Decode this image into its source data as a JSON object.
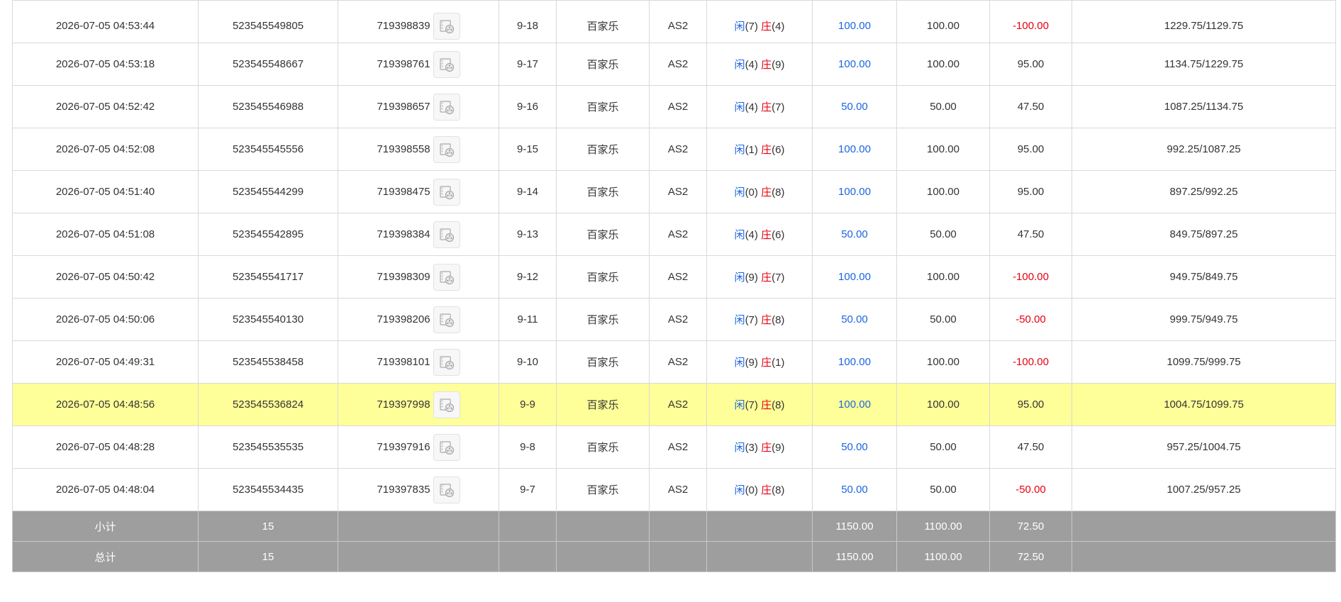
{
  "colors": {
    "blue": "#1a66e0",
    "red": "#e60012",
    "highlight": "#ffff99",
    "summary_bg": "#9e9e9e"
  },
  "rows": [
    {
      "time": "2026-07-05 04:53:44",
      "bet_no": "523545549805",
      "game_no": "719398839",
      "round": "9-18",
      "game": "百家乐",
      "table": "AS2",
      "player_label": "闲",
      "player_val": "(7)",
      "banker_label": "庄",
      "banker_val": "(4)",
      "bet": "100.00",
      "valid": "100.00",
      "win": "-100.00",
      "balance": "1229.75/1129.75"
    },
    {
      "time": "2026-07-05 04:53:18",
      "bet_no": "523545548667",
      "game_no": "719398761",
      "round": "9-17",
      "game": "百家乐",
      "table": "AS2",
      "player_label": "闲",
      "player_val": "(4)",
      "banker_label": "庄",
      "banker_val": "(9)",
      "bet": "100.00",
      "valid": "100.00",
      "win": "95.00",
      "balance": "1134.75/1229.75"
    },
    {
      "time": "2026-07-05 04:52:42",
      "bet_no": "523545546988",
      "game_no": "719398657",
      "round": "9-16",
      "game": "百家乐",
      "table": "AS2",
      "player_label": "闲",
      "player_val": "(4)",
      "banker_label": "庄",
      "banker_val": "(7)",
      "bet": "50.00",
      "valid": "50.00",
      "win": "47.50",
      "balance": "1087.25/1134.75"
    },
    {
      "time": "2026-07-05 04:52:08",
      "bet_no": "523545545556",
      "game_no": "719398558",
      "round": "9-15",
      "game": "百家乐",
      "table": "AS2",
      "player_label": "闲",
      "player_val": "(1)",
      "banker_label": "庄",
      "banker_val": "(6)",
      "bet": "100.00",
      "valid": "100.00",
      "win": "95.00",
      "balance": "992.25/1087.25"
    },
    {
      "time": "2026-07-05 04:51:40",
      "bet_no": "523545544299",
      "game_no": "719398475",
      "round": "9-14",
      "game": "百家乐",
      "table": "AS2",
      "player_label": "闲",
      "player_val": "(0)",
      "banker_label": "庄",
      "banker_val": "(8)",
      "bet": "100.00",
      "valid": "100.00",
      "win": "95.00",
      "balance": "897.25/992.25"
    },
    {
      "time": "2026-07-05 04:51:08",
      "bet_no": "523545542895",
      "game_no": "719398384",
      "round": "9-13",
      "game": "百家乐",
      "table": "AS2",
      "player_label": "闲",
      "player_val": "(4)",
      "banker_label": "庄",
      "banker_val": "(6)",
      "bet": "50.00",
      "valid": "50.00",
      "win": "47.50",
      "balance": "849.75/897.25"
    },
    {
      "time": "2026-07-05 04:50:42",
      "bet_no": "523545541717",
      "game_no": "719398309",
      "round": "9-12",
      "game": "百家乐",
      "table": "AS2",
      "player_label": "闲",
      "player_val": "(9)",
      "banker_label": "庄",
      "banker_val": "(7)",
      "bet": "100.00",
      "valid": "100.00",
      "win": "-100.00",
      "balance": "949.75/849.75"
    },
    {
      "time": "2026-07-05 04:50:06",
      "bet_no": "523545540130",
      "game_no": "719398206",
      "round": "9-11",
      "game": "百家乐",
      "table": "AS2",
      "player_label": "闲",
      "player_val": "(7)",
      "banker_label": "庄",
      "banker_val": "(8)",
      "bet": "50.00",
      "valid": "50.00",
      "win": "-50.00",
      "balance": "999.75/949.75"
    },
    {
      "time": "2026-07-05 04:49:31",
      "bet_no": "523545538458",
      "game_no": "719398101",
      "round": "9-10",
      "game": "百家乐",
      "table": "AS2",
      "player_label": "闲",
      "player_val": "(9)",
      "banker_label": "庄",
      "banker_val": "(1)",
      "bet": "100.00",
      "valid": "100.00",
      "win": "-100.00",
      "balance": "1099.75/999.75"
    },
    {
      "time": "2026-07-05 04:48:56",
      "bet_no": "523545536824",
      "game_no": "719397998",
      "round": "9-9",
      "game": "百家乐",
      "table": "AS2",
      "player_label": "闲",
      "player_val": "(7)",
      "banker_label": "庄",
      "banker_val": "(8)",
      "bet": "100.00",
      "valid": "100.00",
      "win": "95.00",
      "balance": "1004.75/1099.75"
    },
    {
      "time": "2026-07-05 04:48:28",
      "bet_no": "523545535535",
      "game_no": "719397916",
      "round": "9-8",
      "game": "百家乐",
      "table": "AS2",
      "player_label": "闲",
      "player_val": "(3)",
      "banker_label": "庄",
      "banker_val": "(9)",
      "bet": "50.00",
      "valid": "50.00",
      "win": "47.50",
      "balance": "957.25/1004.75"
    },
    {
      "time": "2026-07-05 04:48:04",
      "bet_no": "523545534435",
      "game_no": "719397835",
      "round": "9-7",
      "game": "百家乐",
      "table": "AS2",
      "player_label": "闲",
      "player_val": "(0)",
      "banker_label": "庄",
      "banker_val": "(8)",
      "bet": "50.00",
      "valid": "50.00",
      "win": "-50.00",
      "balance": "1007.25/957.25"
    }
  ],
  "subtotal": {
    "label": "小计",
    "count": "15",
    "bet": "1150.00",
    "valid": "1100.00",
    "win": "72.50"
  },
  "total": {
    "label": "总计",
    "count": "15",
    "bet": "1150.00",
    "valid": "1100.00",
    "win": "72.50"
  }
}
